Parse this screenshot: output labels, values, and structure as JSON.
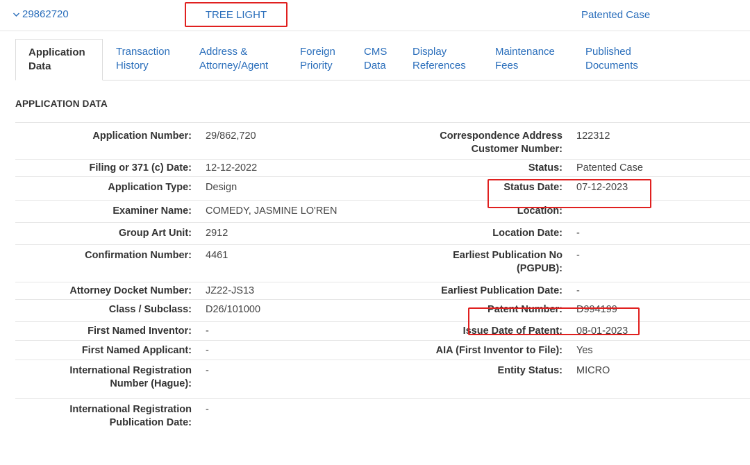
{
  "case": {
    "number": "29862720",
    "title": "TREE LIGHT",
    "status": "Patented Case"
  },
  "tabs": [
    {
      "line1": "Application",
      "line2": "Data"
    },
    {
      "line1": "Transaction",
      "line2": "History"
    },
    {
      "line1": "Address &",
      "line2": "Attorney/Agent"
    },
    {
      "line1": "Foreign",
      "line2": "Priority"
    },
    {
      "line1": "CMS",
      "line2": "Data"
    },
    {
      "line1": "Display",
      "line2": "References"
    },
    {
      "line1": "Maintenance",
      "line2": "Fees"
    },
    {
      "line1": "Published",
      "line2": "Documents"
    }
  ],
  "section_title": "APPLICATION DATA",
  "rows": [
    {
      "left_label": [
        "Application Number:"
      ],
      "left_value": "29/862,720",
      "right_label": [
        "Correspondence Address",
        "Customer Number:"
      ],
      "right_value": "122312"
    },
    {
      "left_label": [
        "Filing or 371 (c) Date:"
      ],
      "left_value": "12-12-2022",
      "right_label": [
        "Status:"
      ],
      "right_value": "Patented Case"
    },
    {
      "left_label": [
        "Application Type:"
      ],
      "left_value": "Design",
      "right_label": [
        "Status Date:"
      ],
      "right_value": "07-12-2023"
    },
    {
      "left_label": [
        "Examiner Name:"
      ],
      "left_value": "COMEDY, JASMINE LO'REN",
      "right_label": [
        "Location:"
      ],
      "right_value": ""
    },
    {
      "left_label": [
        "Group Art Unit:"
      ],
      "left_value": "2912",
      "right_label": [
        "Location Date:"
      ],
      "right_value": "-"
    },
    {
      "left_label": [
        "Confirmation Number:"
      ],
      "left_value": "4461",
      "right_label": [
        "Earliest Publication No",
        "(PGPUB):"
      ],
      "right_value": "-"
    },
    {
      "left_label": [
        "Attorney Docket Number:"
      ],
      "left_value": "JZ22-JS13",
      "right_label": [
        "Earliest Publication Date:"
      ],
      "right_value": "-"
    },
    {
      "left_label": [
        "Class / Subclass:"
      ],
      "left_value": "D26/101000",
      "right_label": [
        "Patent Number:"
      ],
      "right_value": "D994199"
    },
    {
      "left_label": [
        "First Named Inventor:"
      ],
      "left_value": "-",
      "right_label": [
        "Issue Date of Patent:"
      ],
      "right_value": "08-01-2023"
    },
    {
      "left_label": [
        "First Named Applicant:"
      ],
      "left_value": "-",
      "right_label": [
        "AIA (First Inventor to File):"
      ],
      "right_value": "Yes"
    },
    {
      "left_label": [
        "International Registration",
        "Number (Hague):"
      ],
      "left_value": "-",
      "right_label": [
        "Entity Status:"
      ],
      "right_value": "MICRO"
    },
    {
      "left_label": [
        "International Registration",
        "Publication Date:"
      ],
      "left_value": "-",
      "right_label": [],
      "right_value": ""
    }
  ],
  "colors": {
    "link": "#2a6ebb",
    "highlight_box": "#e0201f",
    "text": "#333333",
    "divider": "#e6e6e6"
  },
  "icons": {
    "case_toggle": "chevron-down-icon"
  }
}
